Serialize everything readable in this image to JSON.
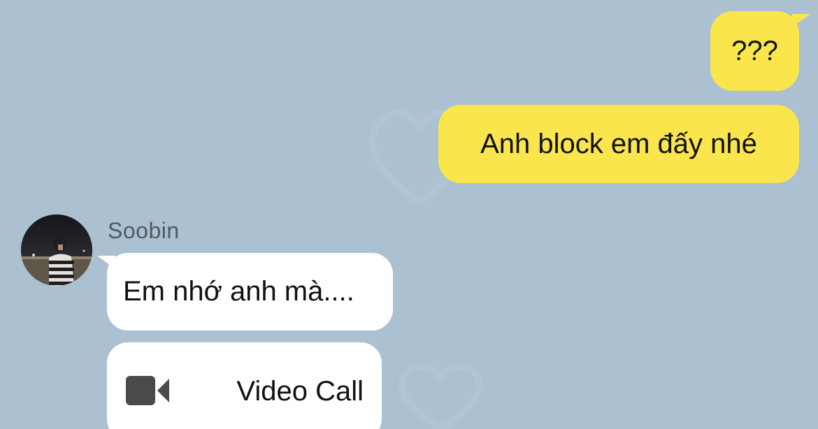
{
  "outgoing": [
    {
      "text": "???"
    },
    {
      "text": "Anh block em đấy nhé"
    }
  ],
  "incoming": {
    "sender_name": "Soobin",
    "message": "Em nhớ anh mà....",
    "video_call_label": "Video Call"
  },
  "icons": {
    "video_call": "video-camera-icon",
    "avatar": "profile-photo"
  },
  "colors": {
    "background": "#abc1d1",
    "outgoing_bubble": "#fae64c",
    "incoming_bubble": "#ffffff",
    "icon_dark": "#4a4a4a"
  }
}
